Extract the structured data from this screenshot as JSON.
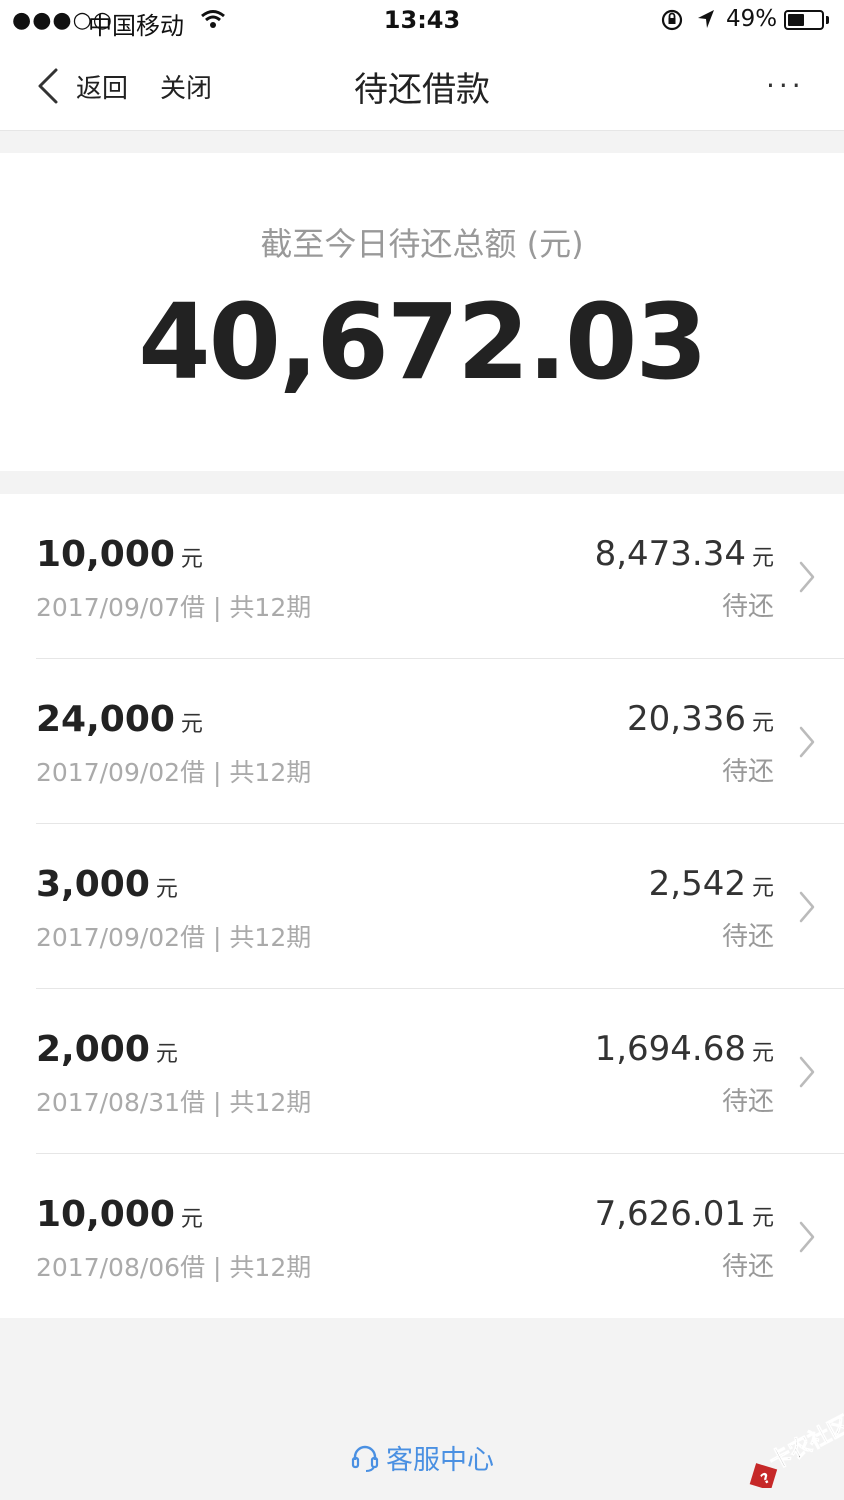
{
  "status_bar": {
    "signal": "●●●○○",
    "carrier": "中国移动",
    "time": "13:43",
    "battery_percent": "49%",
    "battery_level": 0.49
  },
  "nav": {
    "back_label": "返回",
    "close_label": "关闭",
    "title": "待还借款",
    "more_label": "···"
  },
  "summary": {
    "label": "截至今日待还总额 (元)",
    "total": "40,672.03"
  },
  "loans": [
    {
      "amount": "10,000",
      "unit": "元",
      "meta": "2017/09/07借 | 共12期",
      "remaining": "8,473.34",
      "remaining_unit": "元",
      "status": "待还"
    },
    {
      "amount": "24,000",
      "unit": "元",
      "meta": "2017/09/02借 | 共12期",
      "remaining": "20,336",
      "remaining_unit": "元",
      "status": "待还"
    },
    {
      "amount": "3,000",
      "unit": "元",
      "meta": "2017/09/02借 | 共12期",
      "remaining": "2,542",
      "remaining_unit": "元",
      "status": "待还"
    },
    {
      "amount": "2,000",
      "unit": "元",
      "meta": "2017/08/31借 | 共12期",
      "remaining": "1,694.68",
      "remaining_unit": "元",
      "status": "待还"
    },
    {
      "amount": "10,000",
      "unit": "元",
      "meta": "2017/08/06借 | 共12期",
      "remaining": "7,626.01",
      "remaining_unit": "元",
      "status": "待还"
    }
  ],
  "footer": {
    "customer_service": "客服中心",
    "icon": "headset-icon",
    "accent": "#4a90e2"
  },
  "watermark": {
    "text": "卡农社区"
  }
}
